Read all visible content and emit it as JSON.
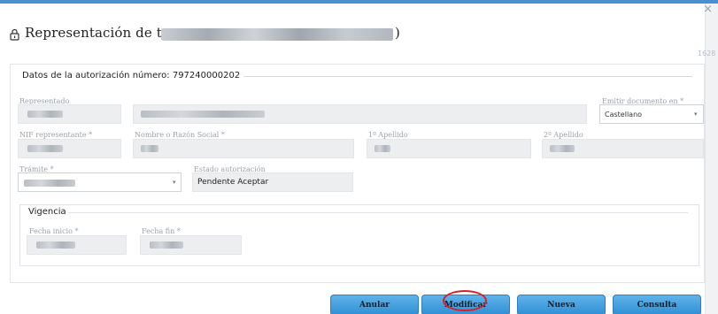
{
  "window": {
    "close_glyph": "×",
    "side_text": "1628"
  },
  "header": {
    "title": "Representación de terceros",
    "title_close": ")"
  },
  "section": {
    "legend": "Datos de la autorización número: 797240000202"
  },
  "fields": {
    "representado_label": "Representado",
    "idioma_label": "Emitir documento en *",
    "idioma_value": "Castellano",
    "nif_label": "NIF representante *",
    "nombre_label": "Nombre o Razón Social *",
    "apellido1_label": "1º Apellido",
    "apellido2_label": "2º Apellido",
    "tramite_label": "Trámite *",
    "estado_label": "Estado autorización",
    "estado_value": "Pendente Aceptar"
  },
  "vigencia": {
    "title": "Vigencia",
    "inicio_label": "Fecha inicio *",
    "fin_label": "Fecha fin *"
  },
  "buttons": {
    "anular": "Anular",
    "modificar": "Modificar",
    "nueva": "Nueva",
    "consulta": "Consulta"
  },
  "colors": {
    "accent": "#4a8fd0",
    "button": "#3d9ddf",
    "highlight_ring": "#d2232a"
  }
}
